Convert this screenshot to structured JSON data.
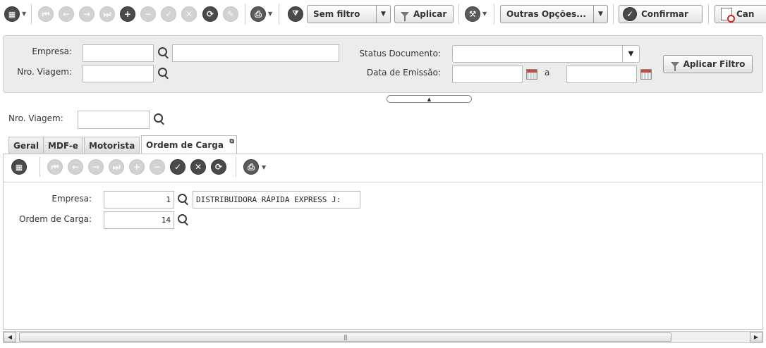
{
  "toolbar": {
    "sem_filtro": "Sem filtro",
    "aplicar": "Aplicar",
    "outras_opcoes": "Outras Opções...",
    "confirmar": "Confirmar",
    "cancelar": "Can"
  },
  "filter": {
    "empresa_label": "Empresa:",
    "nro_viagem_label": "Nro. Viagem:",
    "status_documento_label": "Status Documento:",
    "data_emissao_label": "Data de Emissão:",
    "date_range_sep": "a",
    "aplicar_filtro": "Aplicar Filtro",
    "empresa_code": "",
    "empresa_name": "",
    "nro_viagem": "",
    "status_documento": "",
    "data_inicio": "",
    "data_fim": ""
  },
  "record": {
    "nro_viagem_label": "Nro. Viagem:",
    "nro_viagem_value": ""
  },
  "tabs": [
    {
      "label": "Geral"
    },
    {
      "label": "MDF-e"
    },
    {
      "label": "Motorista"
    },
    {
      "label": "Ordem de Carga"
    }
  ],
  "detail": {
    "empresa_label": "Empresa:",
    "empresa_code": "1",
    "empresa_name": "DISTRIBUIDORA RÁPIDA EXPRESS J:",
    "ordem_carga_label": "Ordem de Carga:",
    "ordem_carga_value": "14"
  },
  "colors": {
    "panel_bg": "#ececec",
    "icon_dark": "#4a4a4a",
    "icon_disabled": "#d2d2d2",
    "cancel_red": "#d22222"
  }
}
